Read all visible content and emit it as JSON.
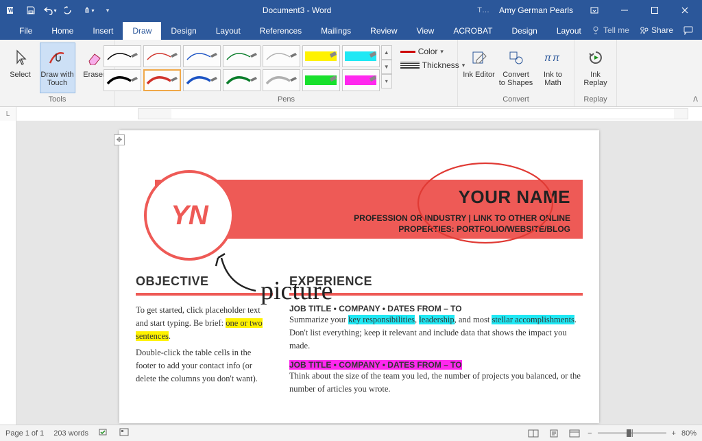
{
  "titlebar": {
    "doc_title": "Document3 - Word",
    "user_name": "Amy German Pearls"
  },
  "tabs": {
    "file": "File",
    "home": "Home",
    "insert": "Insert",
    "draw": "Draw",
    "design": "Design",
    "layout": "Layout",
    "references": "References",
    "mailings": "Mailings",
    "review": "Review",
    "view": "View",
    "acrobat": "ACROBAT",
    "design2": "Design",
    "layout2": "Layout",
    "tellme": "Tell me",
    "share": "Share",
    "active": "Draw"
  },
  "ribbon": {
    "tools": {
      "group_label": "Tools",
      "select": "Select",
      "draw_with_touch": "Draw with Touch",
      "eraser": "Eraser"
    },
    "pens": {
      "group_label": "Pens",
      "color_label": "Color",
      "thickness_label": "Thickness"
    },
    "convert": {
      "group_label": "Convert",
      "ink_editor": "Ink Editor",
      "to_shapes": "Convert to Shapes",
      "to_math": "Ink to Math"
    },
    "replay": {
      "group_label": "Replay",
      "ink_replay": "Ink Replay"
    }
  },
  "document": {
    "header": {
      "initials": "YN",
      "name": "YOUR NAME",
      "subtitle": "PROFESSION OR INDUSTRY | LINK TO OTHER ONLINE PROPERTIES: PORTFOLIO/WEBSITE/BLOG"
    },
    "ink_label": "picture",
    "objective": {
      "title": "OBJECTIVE",
      "p1a": "To get started, click placeholder text and start typing. Be brief: ",
      "p1b_hl": "one or two sentences",
      "p1c": ".",
      "p2": "Double-click the table cells in the footer to add your contact info (or delete the columns you don't want)."
    },
    "experience": {
      "title": "EXPERIENCE",
      "job1_title": "JOB TITLE • COMPANY • DATES FROM – TO",
      "job1_a": "Summarize your ",
      "job1_b_hl": "key responsibilities",
      "job1_c": ", ",
      "job1_d_hl": "leadership",
      "job1_e": ", and most ",
      "job1_f_hl": "stellar accomplishments",
      "job1_g": ".  Don't list everything; keep it relevant and include data that shows the impact you made.",
      "job2_title": "JOB TITLE • COMPANY • DATES FROM – TO",
      "job2_body": "Think about the size of the team you led, the number of projects you balanced, or the number of articles you wrote."
    }
  },
  "status": {
    "page": "Page 1 of 1",
    "words": "203 words",
    "zoom": "80%"
  }
}
